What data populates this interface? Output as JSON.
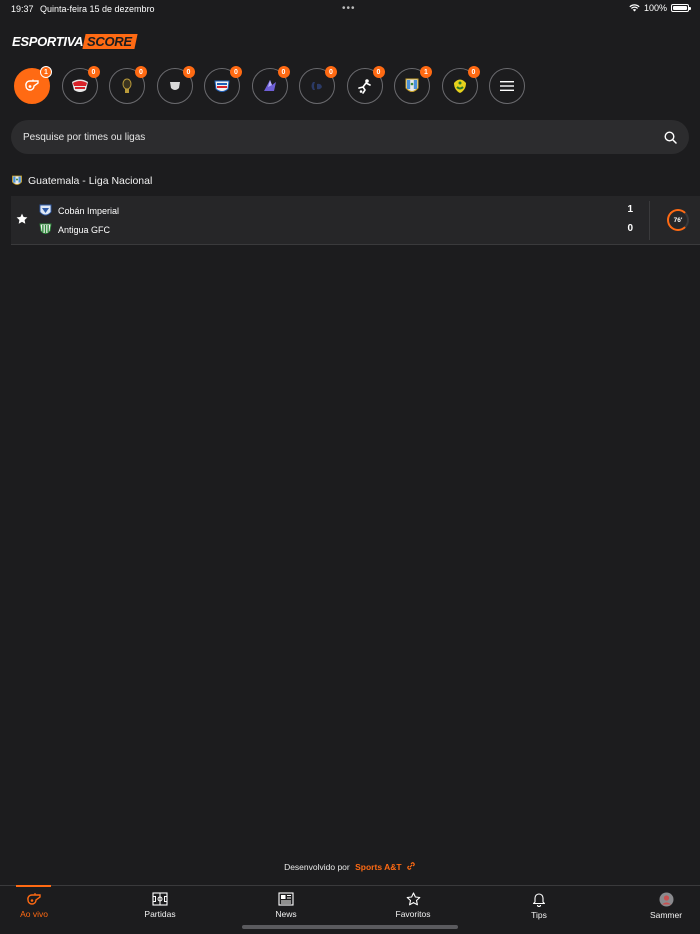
{
  "status": {
    "time": "19:37",
    "date": "Quinta-feira 15 de dezembro",
    "battery": "100%",
    "battery_level": 1.0
  },
  "logo": {
    "part1": "ESPORTIVA",
    "part2": "SCORE"
  },
  "leagues": [
    {
      "id": "live",
      "badge": "1",
      "icon": "whistle-icon",
      "active": true
    },
    {
      "id": "league-2",
      "badge": "0",
      "icon": "league-logo-red"
    },
    {
      "id": "league-3",
      "badge": "0",
      "icon": "league-logo-gold"
    },
    {
      "id": "league-4",
      "badge": "0",
      "icon": "league-logo-white-shield"
    },
    {
      "id": "league-5",
      "badge": "0",
      "icon": "league-logo-blue-red"
    },
    {
      "id": "league-6",
      "badge": "0",
      "icon": "league-logo-purple"
    },
    {
      "id": "league-7",
      "badge": "0",
      "icon": "league-logo-dark-blue"
    },
    {
      "id": "league-8",
      "badge": "0",
      "icon": "league-logo-player"
    },
    {
      "id": "league-9",
      "badge": "1",
      "icon": "league-logo-guatemala"
    },
    {
      "id": "league-10",
      "badge": "0",
      "icon": "league-logo-yellow-green"
    }
  ],
  "search": {
    "placeholder": "Pesquise por times ou ligas",
    "value": ""
  },
  "league_header": {
    "name": "Guatemala - Liga Nacional"
  },
  "match": {
    "home_team": "Cobán Imperial",
    "away_team": "Antigua GFC",
    "home_score": "1",
    "away_score": "0",
    "minute": "76'"
  },
  "footer": {
    "developed_by": "Desenvolvido por",
    "brand": "Sports A&T"
  },
  "tabs": [
    {
      "label": "Ao vivo",
      "icon": "whistle-icon",
      "active": true
    },
    {
      "label": "Partidas",
      "icon": "pitch-icon"
    },
    {
      "label": "News",
      "icon": "newspaper-icon"
    },
    {
      "label": "Favoritos",
      "icon": "star-icon"
    },
    {
      "label": "Tips",
      "icon": "bell-icon"
    },
    {
      "label": "Sammer",
      "icon": "avatar-icon"
    }
  ],
  "colors": {
    "accent": "#ff6a13",
    "background": "#1c1c1e",
    "surface": "#2c2c2e"
  }
}
